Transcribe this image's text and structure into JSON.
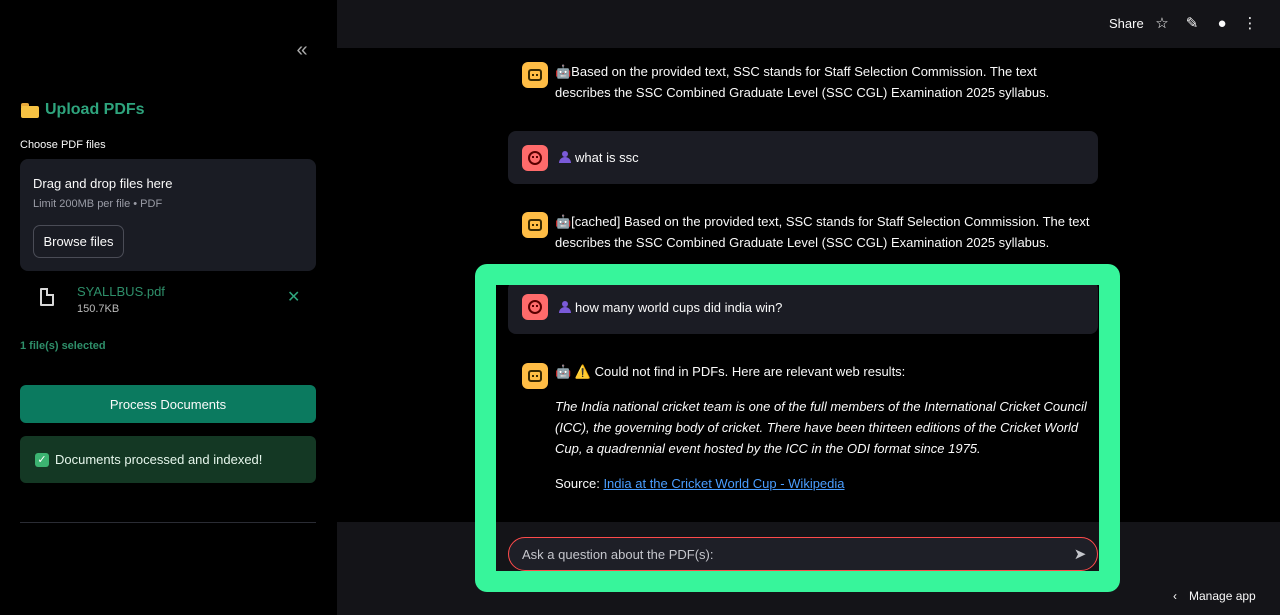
{
  "sidebar": {
    "collapse_icon": "chevrons-left-icon",
    "upload_title": "Upload PDFs",
    "choose_label": "Choose PDF files",
    "dropzone": {
      "title": "Drag and drop files here",
      "limit": "Limit 200MB per file • PDF",
      "browse_label": "Browse files"
    },
    "file": {
      "name": "SYALLBUS.pdf",
      "size": "150.7KB"
    },
    "files_selected": "1 file(s) selected",
    "process_label": "Process Documents",
    "success_message": "Documents processed and indexed!"
  },
  "header": {
    "share_label": "Share"
  },
  "chat": {
    "messages": [
      {
        "role": "assistant",
        "text": "🤖Based on the provided text, SSC stands for Staff Selection Commission. The text describes the SSC Combined Graduate Level (SSC CGL) Examination 2025 syllabus."
      },
      {
        "role": "user",
        "text": "what is ssc"
      },
      {
        "role": "assistant",
        "text": "🤖[cached] Based on the provided text, SSC stands for Staff Selection Commission. The text describes the SSC Combined Graduate Level (SSC CGL) Examination 2025 syllabus."
      },
      {
        "role": "user",
        "text": "how many world cups did india win?"
      },
      {
        "role": "assistant",
        "text": "🤖 ⚠️ Could not find in PDFs. Here are relevant web results:",
        "quote": "The India national cricket team is one of the full members of the International Cricket Council (ICC), the governing body of cricket. There have been thirteen editions of the Cricket World Cup, a quadrennial event hosted by the ICC in the ODI format since 1975.",
        "source_label": "Source:",
        "source_link": "India at the Cricket World Cup - Wikipedia"
      }
    ],
    "input_placeholder": "Ask a question about the PDF(s):"
  },
  "footer": {
    "manage_app": "Manage app"
  },
  "colors": {
    "accent": "#2ea47d",
    "primary_button": "#0b7a5f",
    "highlight": "#37f59b",
    "bot_avatar": "#ffbd45",
    "user_avatar": "#ff6b6b"
  }
}
